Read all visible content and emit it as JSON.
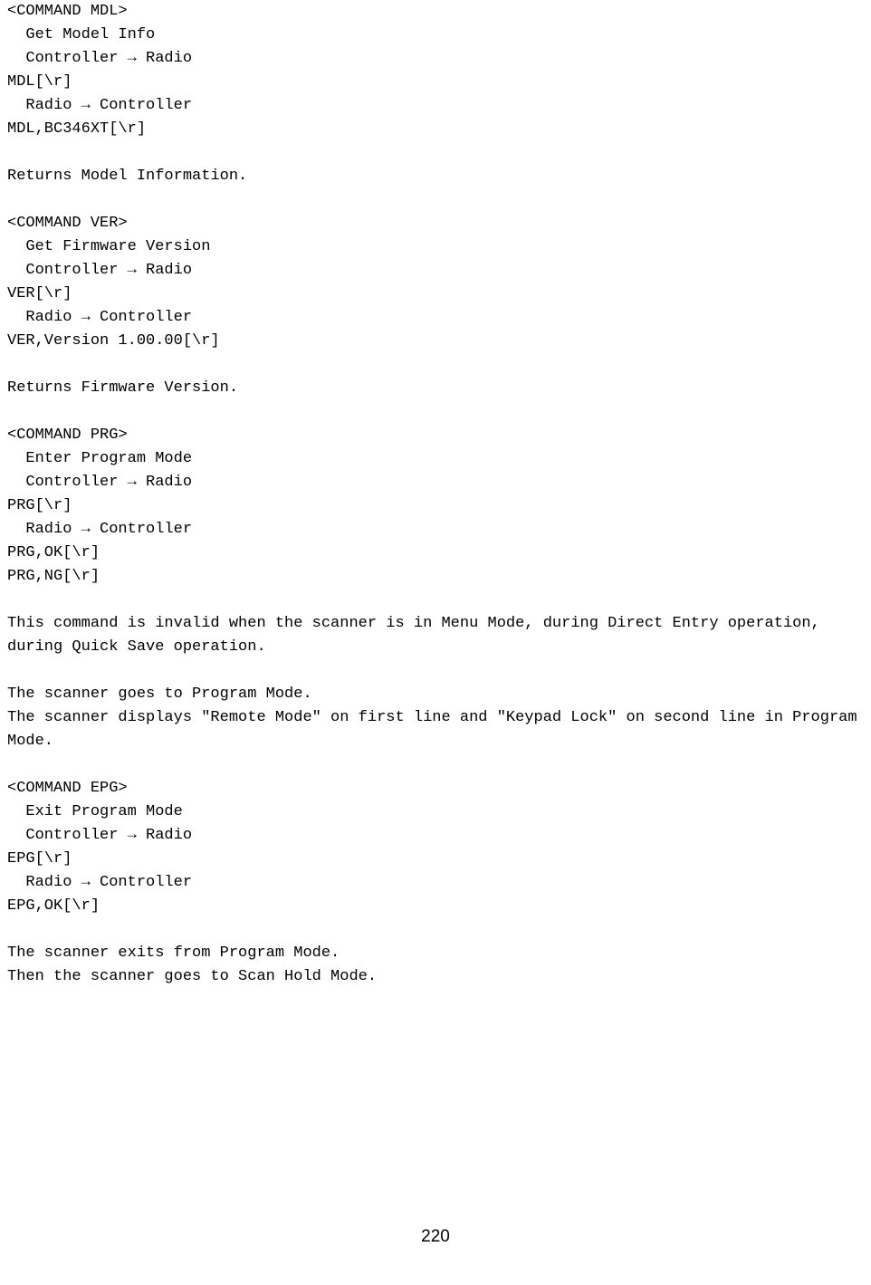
{
  "page": {
    "number": "220"
  },
  "sections": [
    {
      "header": "<COMMAND MDL>",
      "title": "  Get Model Info",
      "ctr_to_radio_label": "  Controller → Radio",
      "ctr_cmd": "MDL[\\r]",
      "radio_to_ctr_label": "  Radio → Controller",
      "radio_resp1": "MDL,BC346XT[\\r]",
      "desc": "Returns Model Information."
    },
    {
      "header": "<COMMAND VER>",
      "title": "  Get Firmware Version",
      "ctr_to_radio_label": "  Controller → Radio",
      "ctr_cmd": "VER[\\r]",
      "radio_to_ctr_label": "  Radio → Controller",
      "radio_resp1": "VER,Version 1.00.00[\\r]",
      "desc": "Returns Firmware Version."
    },
    {
      "header": "<COMMAND PRG>",
      "title": "  Enter Program Mode",
      "ctr_to_radio_label": "  Controller → Radio",
      "ctr_cmd": "PRG[\\r]",
      "radio_to_ctr_label": "  Radio → Controller",
      "radio_resp1": "PRG,OK[\\r]",
      "radio_resp2": "PRG,NG[\\r]",
      "desc": "This command is invalid when the scanner is in Menu Mode, during Direct Entry operation, during Quick Save operation.",
      "desc2": "The scanner goes to Program Mode.\nThe scanner displays \"Remote Mode\" on first line and \"Keypad Lock\" on second line in Program Mode."
    },
    {
      "header": "<COMMAND EPG>",
      "title": "  Exit Program Mode",
      "ctr_to_radio_label": "  Controller → Radio",
      "ctr_cmd": "EPG[\\r]",
      "radio_to_ctr_label": "  Radio → Controller",
      "radio_resp1": "EPG,OK[\\r]",
      "desc": "The scanner exits from Program Mode.\nThen the scanner goes to Scan Hold Mode."
    }
  ]
}
